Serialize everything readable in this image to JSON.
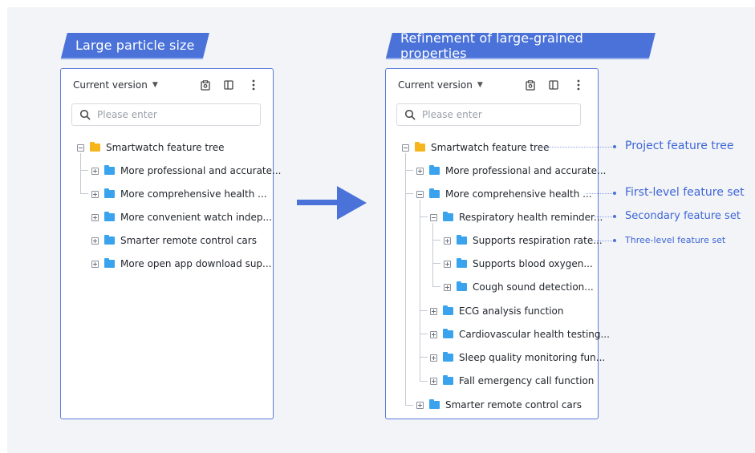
{
  "colors": {
    "accent": "#4a72d9",
    "panel_border": "#5b7bd8",
    "folder_root": "#f6b61b",
    "folder": "#3aa3ee",
    "annotation": "#3d66d6",
    "background": "#f3f4f7"
  },
  "left": {
    "banner": "Large particle size",
    "version_label": "Current version",
    "search_placeholder": "Please enter",
    "tree": {
      "root": "Smartwatch feature tree",
      "items": [
        "More professional and accurate...",
        "More comprehensive health ...",
        "More convenient watch indep...",
        "Smarter remote control cars",
        "More open app download sup..."
      ]
    }
  },
  "right": {
    "banner": "Refinement of large-grained properties",
    "version_label": "Current version",
    "search_placeholder": "Please enter",
    "tree": {
      "root": "Smartwatch feature tree",
      "level1_a": "More professional and accurate...",
      "level1_b": "More comprehensive health ...",
      "level2_first": "Respiratory health reminder...",
      "level3": [
        "Supports respiration rate...",
        "Supports blood oxygen...",
        "Cough sound detection..."
      ],
      "level2_rest": [
        "ECG analysis function",
        "Cardiovascular health testing...",
        "Sleep quality monitoring fun...",
        "Fall emergency call function"
      ],
      "level1_c": "Smarter remote control cars"
    }
  },
  "annotations": {
    "project": "Project feature tree",
    "first": "First-level feature set",
    "second": "Secondary feature set",
    "third": "Three-level feature set"
  },
  "icons": [
    "chevron-down-icon",
    "clipboard-icon",
    "split-view-icon",
    "more-vertical-icon",
    "search-icon",
    "collapse-icon",
    "expand-icon",
    "folder-icon",
    "arrow-right-icon"
  ]
}
